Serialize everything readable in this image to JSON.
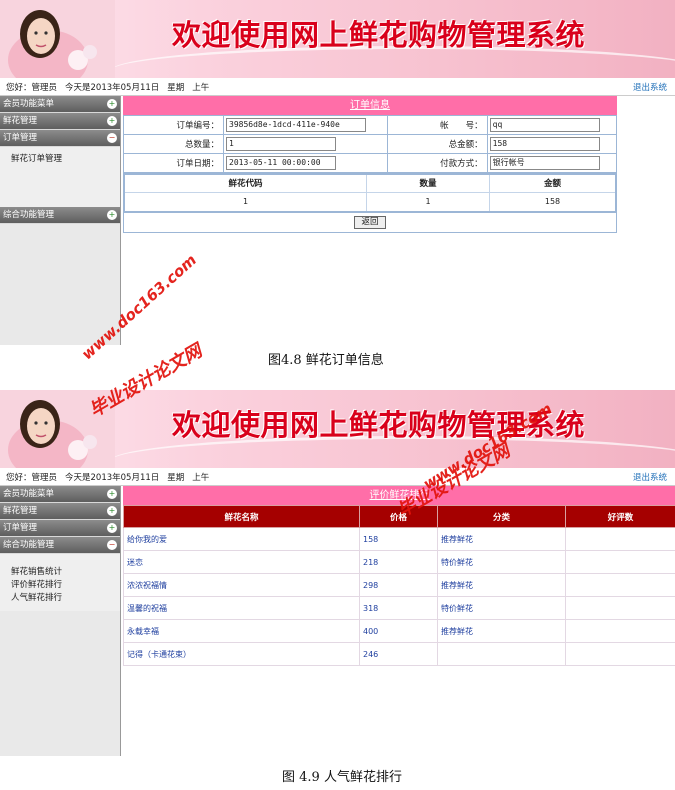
{
  "banner": {
    "title": "欢迎使用网上鲜花购物管理系统"
  },
  "userbar": {
    "greeting": "您好：管理员",
    "date": "今天是2013年05月11日",
    "week": "星期",
    "ampm": "上午",
    "logout": "退出系统"
  },
  "sidebar": {
    "member_menu": "会员功能菜单",
    "flower_mgmt": "鲜花管理",
    "order_mgmt": "订单管理",
    "order_sub": [
      "鲜花订单管理"
    ],
    "stats_mgmt": "综合功能管理",
    "stats_sub": [
      "鲜花销售统计",
      "评价鲜花排行",
      "人气鲜花排行"
    ]
  },
  "order": {
    "title": "订单信息",
    "labels": {
      "order_no": "订单编号：",
      "account": "帐　　号：",
      "total_qty": "总数量：",
      "total_amount": "总金额：",
      "order_date": "订单日期：",
      "payment": "付款方式："
    },
    "values": {
      "order_no": "39856d8e-1dcd-411e-940e",
      "account": "qq",
      "total_qty": "1",
      "total_amount": "158",
      "order_date": "2013-05-11 00:00:00",
      "payment": "银行帐号"
    },
    "item_headers": [
      "鲜花代码",
      "数量",
      "金额"
    ],
    "items": [
      {
        "code": "1",
        "qty": "1",
        "amount": "158"
      }
    ],
    "back_button": "返回"
  },
  "captions": {
    "fig1": "图4.8 鲜花订单信息",
    "fig2": "图 4.9 人气鲜花排行"
  },
  "ranking": {
    "title": "评价鲜花排行",
    "headers": [
      "鲜花名称",
      "价格",
      "分类",
      "好评数"
    ],
    "rows": [
      {
        "name": "给你我的爱",
        "price": "158",
        "category": "推荐鲜花",
        "score": ""
      },
      {
        "name": "迷恋",
        "price": "218",
        "category": "特价鲜花",
        "score": ""
      },
      {
        "name": "浓浓祝福情",
        "price": "298",
        "category": "推荐鲜花",
        "score": ""
      },
      {
        "name": "温馨的祝福",
        "price": "318",
        "category": "特价鲜花",
        "score": ""
      },
      {
        "name": "永载幸福",
        "price": "400",
        "category": "推荐鲜花",
        "score": ""
      },
      {
        "name": "记得（卡通花束）",
        "price": "246",
        "category": "",
        "score": ""
      }
    ]
  },
  "watermarks": {
    "site": "www.doc163.com",
    "slogan": "毕业设计论文网"
  }
}
